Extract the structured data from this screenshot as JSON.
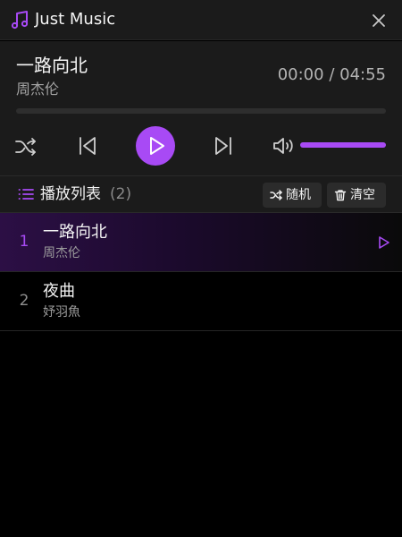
{
  "window": {
    "title": "Just Music",
    "accent_color": "#a84af5"
  },
  "now_playing": {
    "title": "一路向北",
    "artist": "周杰伦",
    "current_time": "00:00",
    "total_time": "04:55",
    "time_separator": "/",
    "progress": 0.0,
    "volume": 1.0
  },
  "controls": {
    "shuffle_icon": "shuffle-icon",
    "prev_icon": "skip-previous-icon",
    "play_icon": "play-icon",
    "next_icon": "skip-next-icon",
    "volume_icon": "volume-icon"
  },
  "playlist": {
    "title": "播放列表",
    "count": "(2)",
    "random_label": "随机",
    "clear_label": "清空",
    "items": [
      {
        "num": "1",
        "title": "一路向北",
        "artist": "周杰伦",
        "active": true
      },
      {
        "num": "2",
        "title": "夜曲",
        "artist": "妤羽魚",
        "active": false
      }
    ]
  }
}
